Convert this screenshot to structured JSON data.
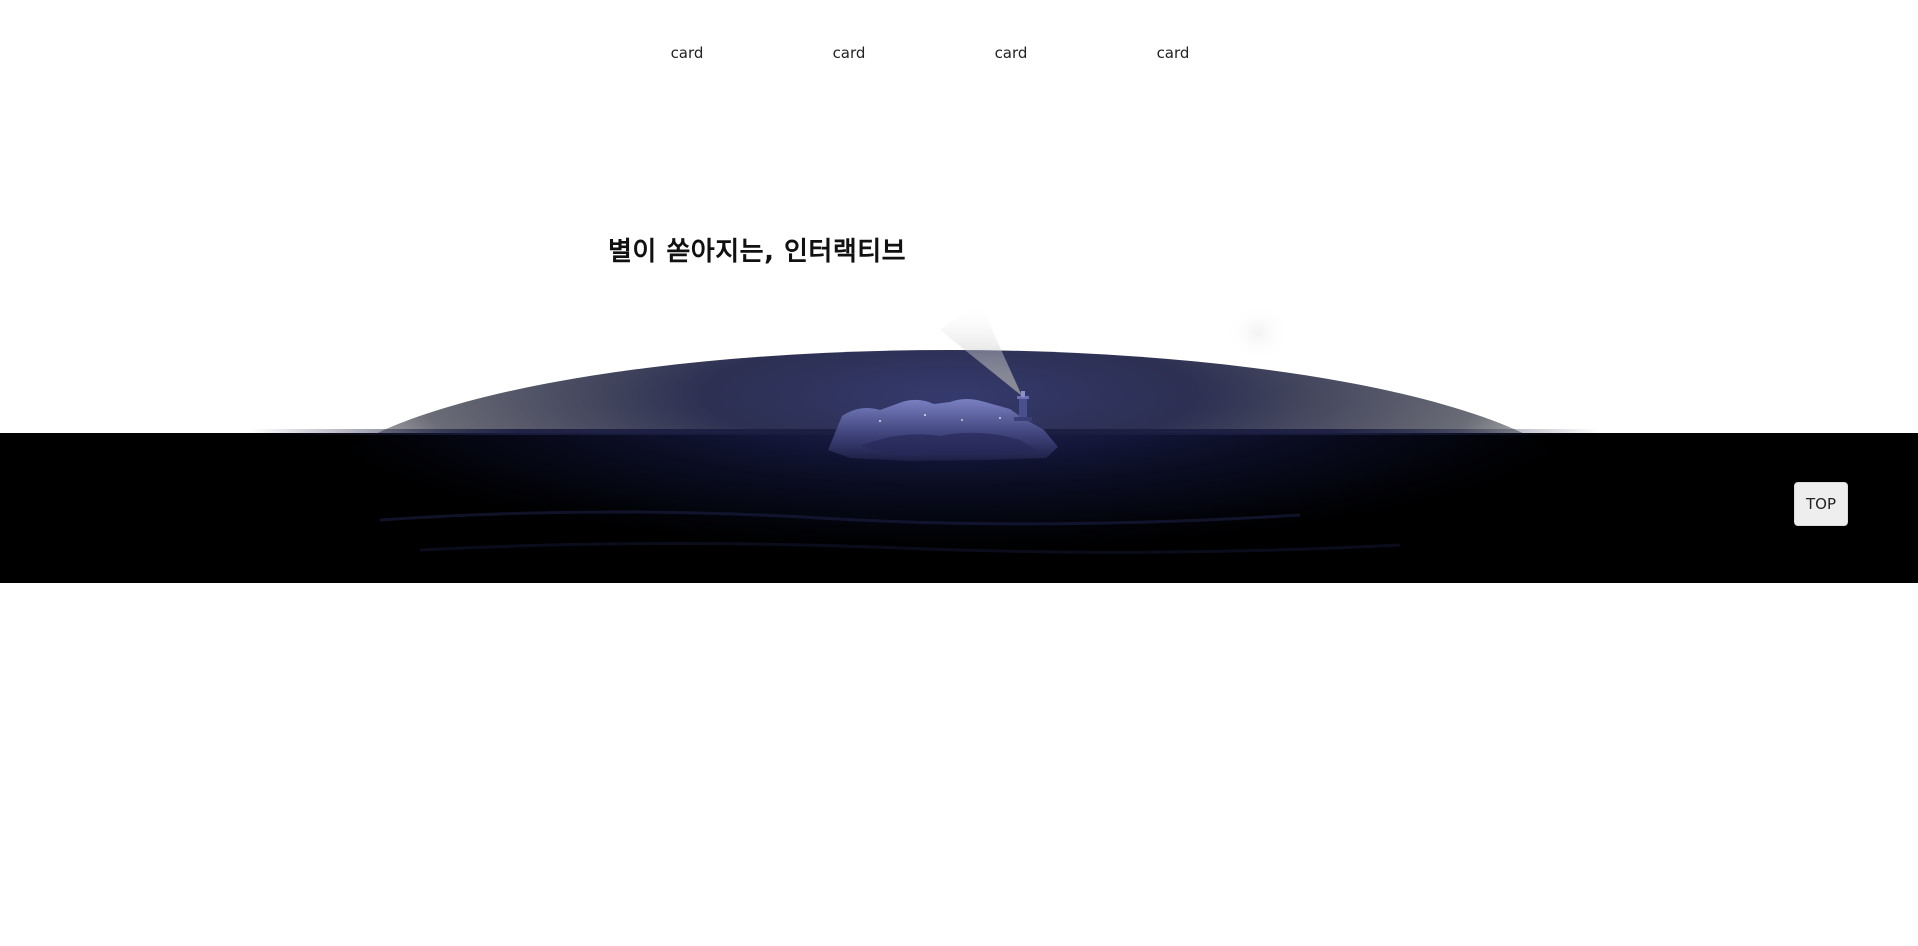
{
  "nav": {
    "items": [
      {
        "label": "card"
      },
      {
        "label": "card"
      },
      {
        "label": "card"
      },
      {
        "label": "card"
      }
    ]
  },
  "hero": {
    "title": "별이 쏟아지는, 인터랙티브"
  },
  "scene": {
    "sea_color": "#000000",
    "island_color": "#5a5f9a",
    "water_color": "#0b0f2a",
    "icons": [
      "lighthouse-icon",
      "island-icon",
      "moon-glow"
    ]
  },
  "top_button": {
    "label": "TOP"
  }
}
